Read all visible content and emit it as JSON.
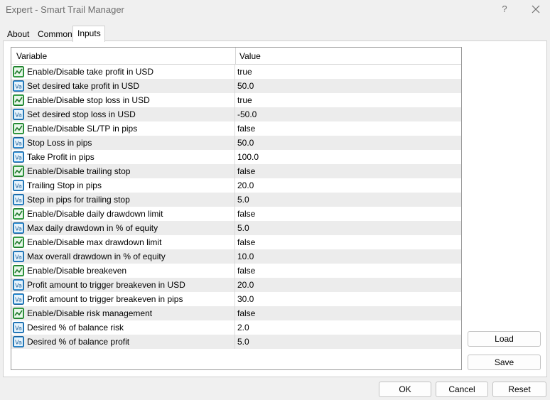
{
  "window": {
    "title": "Expert - Smart Trail Manager",
    "help": "?"
  },
  "tabs": [
    {
      "label": "About"
    },
    {
      "label": "Common"
    },
    {
      "label": "Inputs"
    }
  ],
  "grid": {
    "header_variable": "Variable",
    "header_value": "Value",
    "rows": [
      {
        "label": "Enable/Disable take profit in USD",
        "value": "true",
        "icon": "bool-icon"
      },
      {
        "label": "Set desired take profit in USD",
        "value": "50.0",
        "icon": "value-icon"
      },
      {
        "label": "Enable/Disable stop loss in USD",
        "value": "true",
        "icon": "bool-icon"
      },
      {
        "label": "Set desired stop loss in USD",
        "value": "-50.0",
        "icon": "value-icon"
      },
      {
        "label": "Enable/Disable SL/TP in pips",
        "value": "false",
        "icon": "bool-icon"
      },
      {
        "label": "Stop Loss in pips",
        "value": "50.0",
        "icon": "value-icon"
      },
      {
        "label": "Take Profit in pips",
        "value": "100.0",
        "icon": "value-icon"
      },
      {
        "label": "Enable/Disable trailing stop",
        "value": "false",
        "icon": "bool-icon"
      },
      {
        "label": "Trailing Stop in pips",
        "value": "20.0",
        "icon": "value-icon"
      },
      {
        "label": "Step in pips for trailing stop",
        "value": "5.0",
        "icon": "value-icon"
      },
      {
        "label": "Enable/Disable daily drawdown limit",
        "value": "false",
        "icon": "bool-icon"
      },
      {
        "label": "Max daily drawdown in % of equity",
        "value": "5.0",
        "icon": "value-icon"
      },
      {
        "label": "Enable/Disable max drawdown limit",
        "value": "false",
        "icon": "bool-icon"
      },
      {
        "label": "Max overall drawdown in % of equity",
        "value": "10.0",
        "icon": "value-icon"
      },
      {
        "label": "Enable/Disable breakeven",
        "value": "false",
        "icon": "bool-icon"
      },
      {
        "label": "Profit amount to trigger breakeven in USD",
        "value": "20.0",
        "icon": "value-icon"
      },
      {
        "label": "Profit amount to trigger breakeven in pips",
        "value": "30.0",
        "icon": "value-icon"
      },
      {
        "label": "Enable/Disable risk management",
        "value": "false",
        "icon": "bool-icon"
      },
      {
        "label": "Desired % of balance risk",
        "value": "2.0",
        "icon": "value-icon"
      },
      {
        "label": "Desired % of balance profit",
        "value": "5.0",
        "icon": "value-icon"
      }
    ]
  },
  "side_buttons": {
    "load": "Load",
    "save": "Save"
  },
  "footer": {
    "ok": "OK",
    "cancel": "Cancel",
    "reset": "Reset"
  }
}
